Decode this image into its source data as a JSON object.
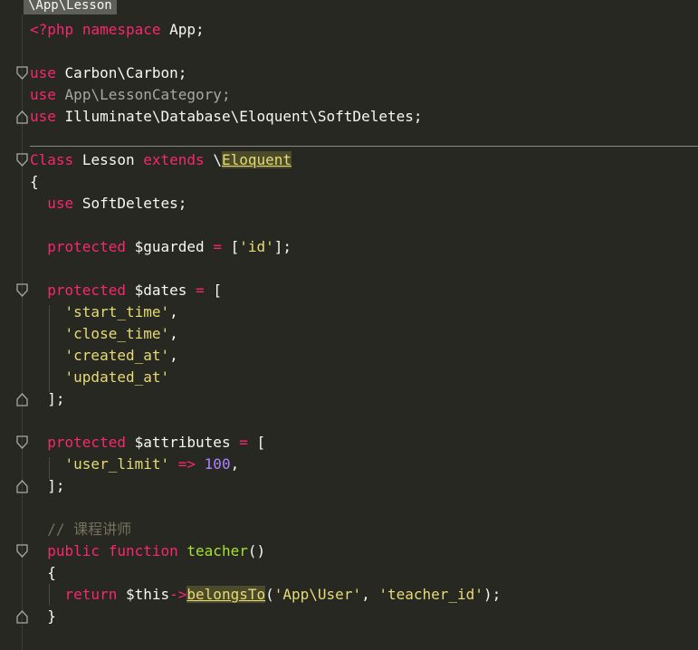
{
  "breadcrumb": "\\App\\Lesson",
  "code": {
    "l1_open": "<?php",
    "l1_ns_kw": "namespace",
    "l1_ns": "App;",
    "use_kw": "use",
    "l2_cls": "Carbon\\Carbon;",
    "l3_cls": "App\\LessonCategory;",
    "l4_cls": "Illuminate\\Database\\Eloquent\\SoftDeletes;",
    "class_kw": "Class",
    "class_name": "Lesson",
    "extends_kw": "extends",
    "backslash": "\\",
    "parent": "Eloquent",
    "open_brace": "{",
    "close_brace": "}",
    "use_trait": "SoftDeletes;",
    "protected_kw": "protected",
    "guarded_var": "$guarded",
    "eq": "=",
    "lbr": "[",
    "rbr": "];",
    "id_str": "'id'",
    "dates_var": "$dates",
    "date_items": [
      "'start_time'",
      "'close_time'",
      "'created_at'",
      "'updated_at'"
    ],
    "comma": ",",
    "attrs_var": "$attributes",
    "user_limit_key": "'user_limit'",
    "arrow": "=>",
    "user_limit_val": "100",
    "comment": "// 课程讲师",
    "public_kw": "public",
    "function_kw": "function",
    "fn_name": "teacher",
    "parens": "()",
    "return_kw": "return",
    "this_var": "$this",
    "obj_arrow": "->",
    "belongs": "belongsTo",
    "lparen": "(",
    "rparen_end": ");",
    "arg1": "'App\\User'",
    "arg_sep": ", ",
    "arg2": "'teacher_id'"
  }
}
